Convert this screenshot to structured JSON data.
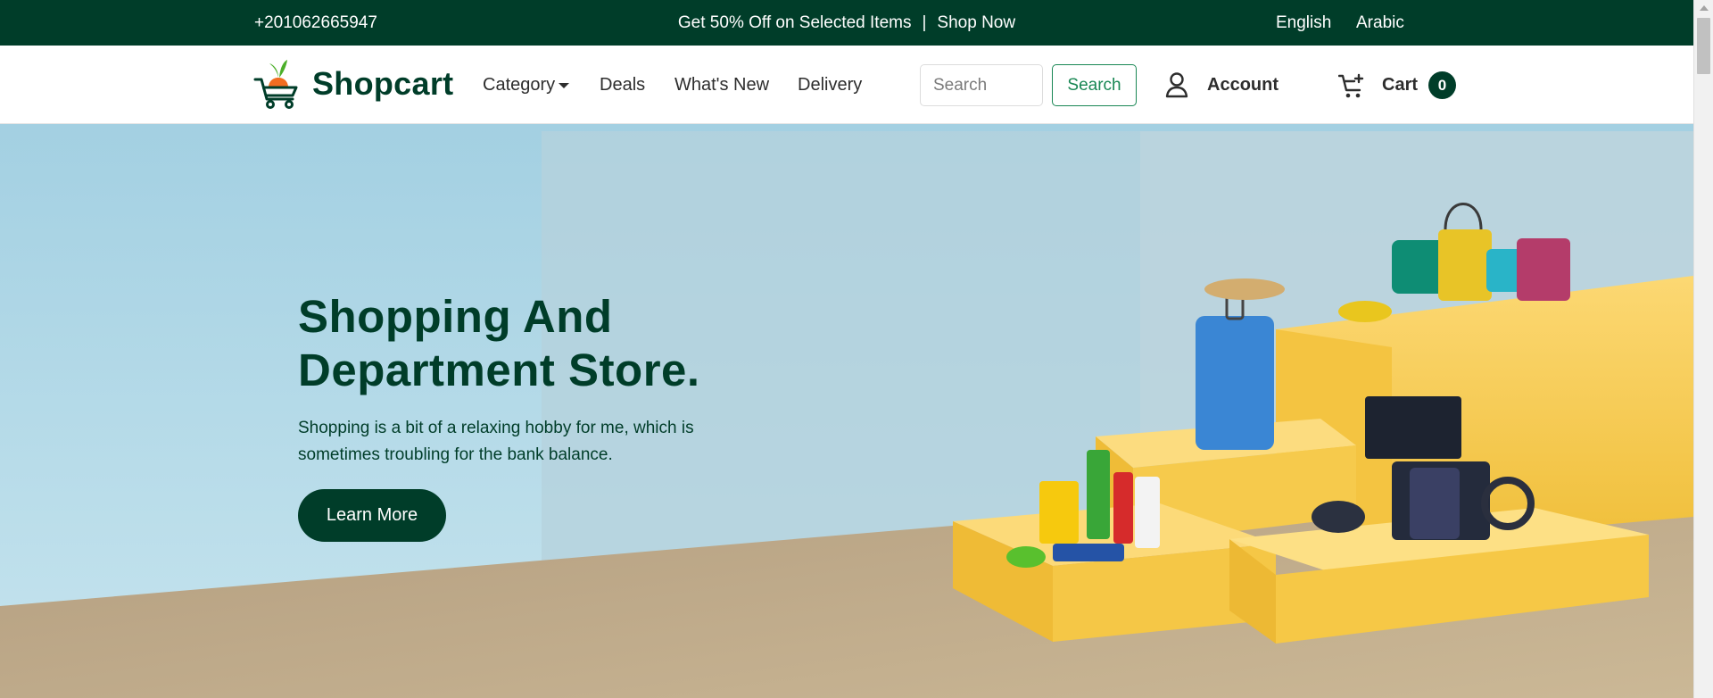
{
  "topbar": {
    "phone": "+201062665947",
    "promo_text": "Get 50% Off on Selected Items",
    "promo_separator": "|",
    "promo_link": "Shop Now",
    "languages": [
      "English",
      "Arabic"
    ]
  },
  "nav": {
    "logo_text": "Shopcart",
    "menu": [
      {
        "label": "Category",
        "has_dropdown": true
      },
      {
        "label": "Deals"
      },
      {
        "label": "What's New"
      },
      {
        "label": "Delivery"
      }
    ],
    "search": {
      "placeholder": "Search",
      "value": "",
      "button_label": "Search"
    },
    "account_label": "Account",
    "cart_label": "Cart",
    "cart_count": "0"
  },
  "hero": {
    "title_line1": "Shopping And",
    "title_line2": "Department Store.",
    "description": "Shopping is a bit of a relaxing hobby for me, which is sometimes troubling for the bank balance.",
    "cta_label": "Learn More"
  },
  "colors": {
    "brand_dark_green": "#003d29",
    "accent_green": "#198754",
    "logo_orange": "#f26d21",
    "logo_leaf": "#4caf2a",
    "hero_sky": "#a9d4e3",
    "hero_floor": "#c7b292",
    "podium_yellow": "#f7c94b"
  },
  "icons": {
    "logo": "cart-logo-icon",
    "dropdown": "caret-down-icon",
    "account": "user-icon",
    "cart": "cart-icon",
    "scroll": "scroll-up-arrow-icon"
  }
}
